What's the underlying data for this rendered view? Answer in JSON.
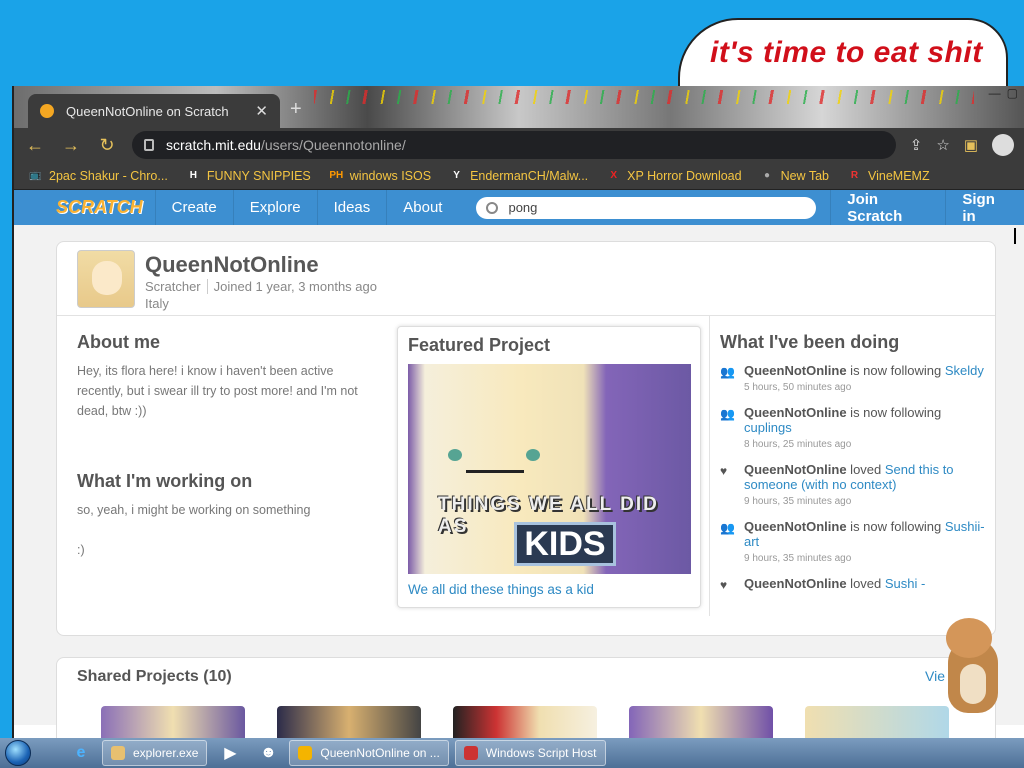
{
  "meme": {
    "line1": "it's time to eat shit",
    "line2": "…"
  },
  "browser": {
    "tab_title": "QueenNotOnline on Scratch",
    "tab_close": "✕",
    "new_tab": "+",
    "url_host": "scratch.mit.edu",
    "url_path": "/users/Queennotonline/",
    "window_controls": [
      "—",
      "▢"
    ]
  },
  "bookmarks": [
    {
      "label": "2pac Shakur - Chro...",
      "icon": "📺",
      "color": "#c94"
    },
    {
      "label": "FUNNY SNIPPIES",
      "icon": "H",
      "color": "#fff"
    },
    {
      "label": "windows ISOS",
      "icon": "PH",
      "color": "#f90"
    },
    {
      "label": "EndermanCH/Malw...",
      "icon": "Y",
      "color": "#fff"
    },
    {
      "label": "XP Horror Download",
      "icon": "X",
      "color": "#e22"
    },
    {
      "label": "New Tab",
      "icon": "●",
      "color": "#aaa"
    },
    {
      "label": "VineMEMZ",
      "icon": "R",
      "color": "#e33"
    }
  ],
  "scratch_nav": {
    "logo": "SCRATCH",
    "items": [
      "Create",
      "Explore",
      "Ideas",
      "About"
    ],
    "search_value": "pong",
    "join": "Join Scratch",
    "sign_in": "Sign in"
  },
  "profile": {
    "username": "QueenNotOnline",
    "role": "Scratcher",
    "joined": "Joined 1 year, 3 months ago",
    "country": "Italy"
  },
  "about": {
    "heading": "About me",
    "text": "Hey, its flora here! i know i haven't been active recently, but i swear ill try to post more! and I'm not dead, btw :))",
    "working_heading": "What I'm working on",
    "working_text": "so, yeah, i might be working on something",
    "working_text2": ":)"
  },
  "featured": {
    "heading": "Featured Project",
    "thumb_line1": "THINGS WE ALL DID AS",
    "thumb_line2": "KIDS",
    "title": "We all did these things as a kid"
  },
  "activity": {
    "heading": "What I've been doing",
    "items": [
      {
        "icon": "follow-icon",
        "user": "QueenNotOnline",
        "action": " is now following ",
        "target": "Skeldy",
        "time": "5 hours, 50 minutes ago"
      },
      {
        "icon": "follow-icon",
        "user": "QueenNotOnline",
        "action": " is now following ",
        "target": "cuplings",
        "time": "8 hours, 25 minutes ago"
      },
      {
        "icon": "heart-icon",
        "user": "QueenNotOnline",
        "action": " loved ",
        "target": "Send this to someone (with no context)",
        "time": "9 hours, 35 minutes ago"
      },
      {
        "icon": "follow-icon",
        "user": "QueenNotOnline",
        "action": " is now following ",
        "target": "Sushii-art",
        "time": "9 hours, 35 minutes ago"
      },
      {
        "icon": "heart-icon",
        "user": "QueenNotOnline",
        "action": " loved ",
        "target": "Sushi -",
        "time": ""
      }
    ]
  },
  "shared": {
    "heading": "Shared Projects (10)",
    "view_all": "Vie"
  },
  "taskbar": {
    "tasks": [
      {
        "label": "explorer.exe",
        "color": "#e8c070"
      },
      {
        "label": "QueenNotOnline on ...",
        "color": "#f4b400"
      },
      {
        "label": "Windows Script Host",
        "color": "#c33"
      }
    ]
  }
}
